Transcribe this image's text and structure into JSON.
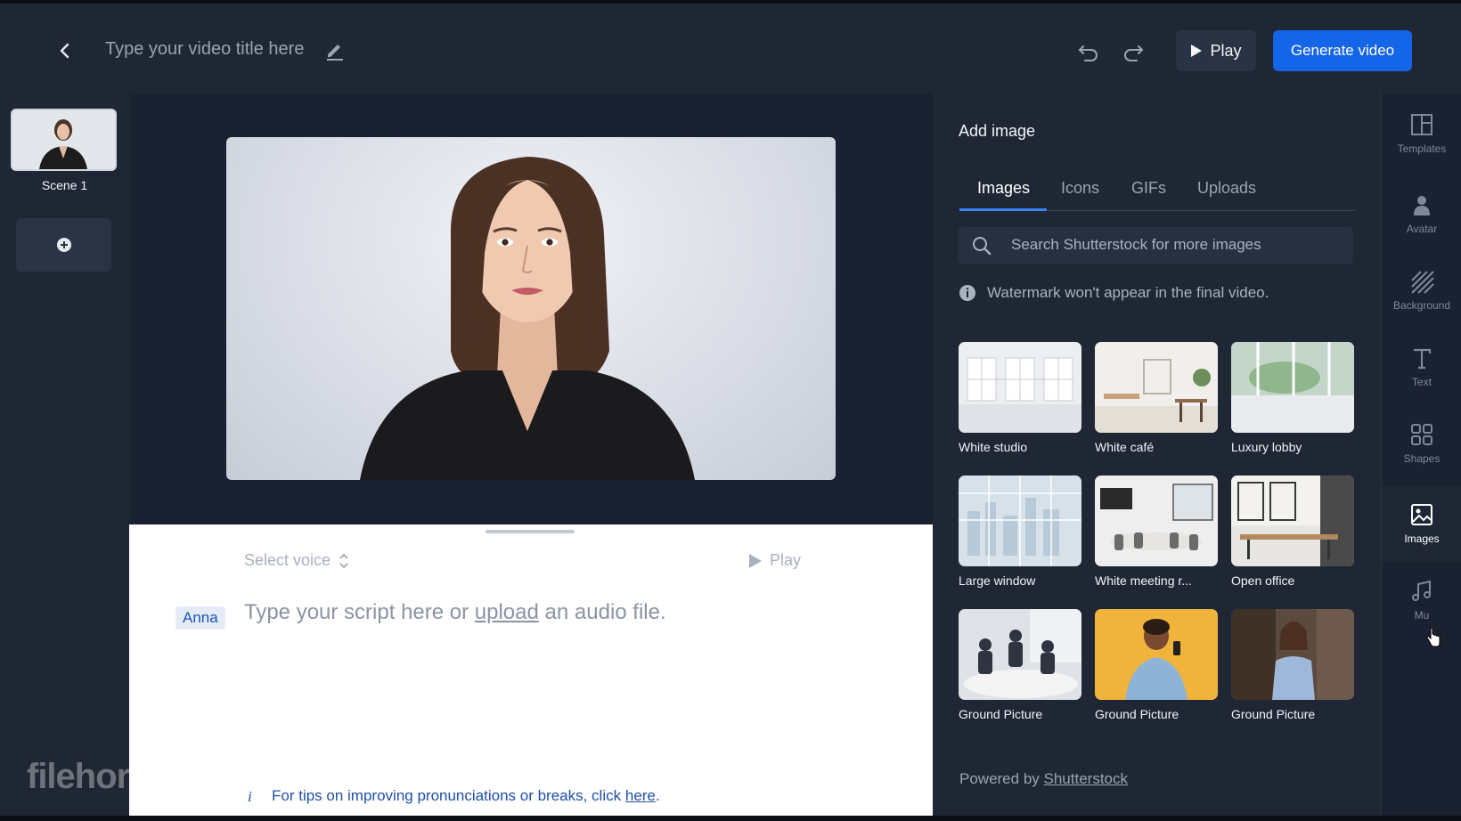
{
  "header": {
    "title": "Type your video title here",
    "play_label": "Play",
    "generate_label": "Generate video"
  },
  "scenes": {
    "items": [
      {
        "label": "Scene 1"
      }
    ]
  },
  "script_panel": {
    "select_voice": "Select voice",
    "play_label": "Play",
    "voice_name": "Anna",
    "script_prefix": "Type your script here or",
    "script_link": "upload",
    "script_suffix": "an audio file.",
    "tips_text": "For tips on improving pronunciations or breaks, click",
    "tips_link": "here",
    "tips_end": "."
  },
  "image_panel": {
    "title": "Add image",
    "tabs": [
      "Images",
      "Icons",
      "GIFs",
      "Uploads"
    ],
    "active_tab": "Images",
    "search_placeholder": "Search Shutterstock for more images",
    "watermark_note": "Watermark won't appear in the final video.",
    "tiles": [
      {
        "label": "White studio"
      },
      {
        "label": "White café"
      },
      {
        "label": "Luxury lobby"
      },
      {
        "label": "Large window"
      },
      {
        "label": "White meeting r..."
      },
      {
        "label": "Open office"
      },
      {
        "label": "Ground Picture"
      },
      {
        "label": "Ground Picture"
      },
      {
        "label": "Ground Picture"
      }
    ],
    "powered_prefix": "Powered by",
    "powered_link": "Shutterstock"
  },
  "rail": {
    "items": [
      {
        "label": "Templates",
        "icon": "layout-icon"
      },
      {
        "label": "Avatar",
        "icon": "person-icon"
      },
      {
        "label": "Background",
        "icon": "hatch-icon"
      },
      {
        "label": "Text",
        "icon": "text-icon"
      },
      {
        "label": "Shapes",
        "icon": "shapes-icon"
      },
      {
        "label": "Images",
        "icon": "image-icon"
      },
      {
        "label": "Mu",
        "icon": "music-icon"
      }
    ],
    "active": "Images"
  },
  "watermark_logo": "filehorse.com",
  "colors": {
    "accent": "#1565e8",
    "tab_underline": "#3b82f6",
    "background": "#1d2533",
    "voice_chip": "#1a52b8"
  }
}
